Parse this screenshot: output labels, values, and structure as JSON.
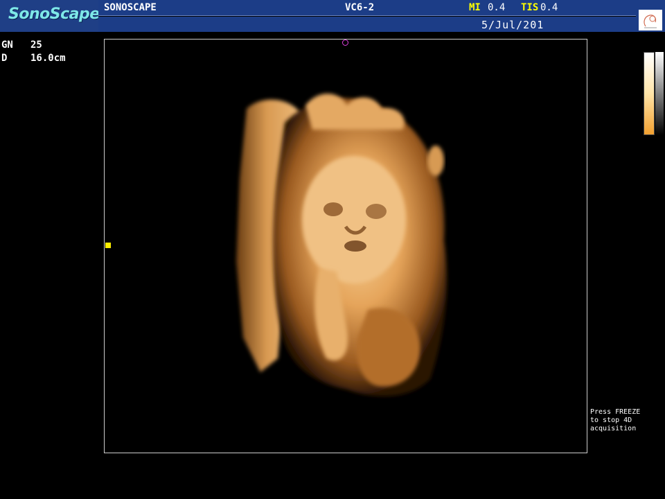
{
  "header": {
    "logo": "SonoScape",
    "brand": "SONOSCAPE",
    "probe": "VC6-2",
    "mi_label": "MI",
    "mi_value": "0.4",
    "tis_label": "TIS",
    "tis_value": "0.4",
    "date": "5/Jul/201"
  },
  "params": {
    "gain_label": "GN",
    "gain_value": "25",
    "depth_label": "D",
    "depth_value": "16.0cm"
  },
  "status": {
    "line1": "Press FREEZE",
    "line2": "to stop 4D",
    "line3": "acquisition"
  },
  "icons": {
    "orientation": "orientation-circle-icon",
    "focus_marker": "focus-marker-icon",
    "thumbnail": "probe-thumbnail-icon"
  },
  "colors": {
    "header_bg": "#1c3d87",
    "logo_text": "#7ee8e8",
    "label_yellow": "#ffff00",
    "render_tint": "#e7a24f"
  }
}
